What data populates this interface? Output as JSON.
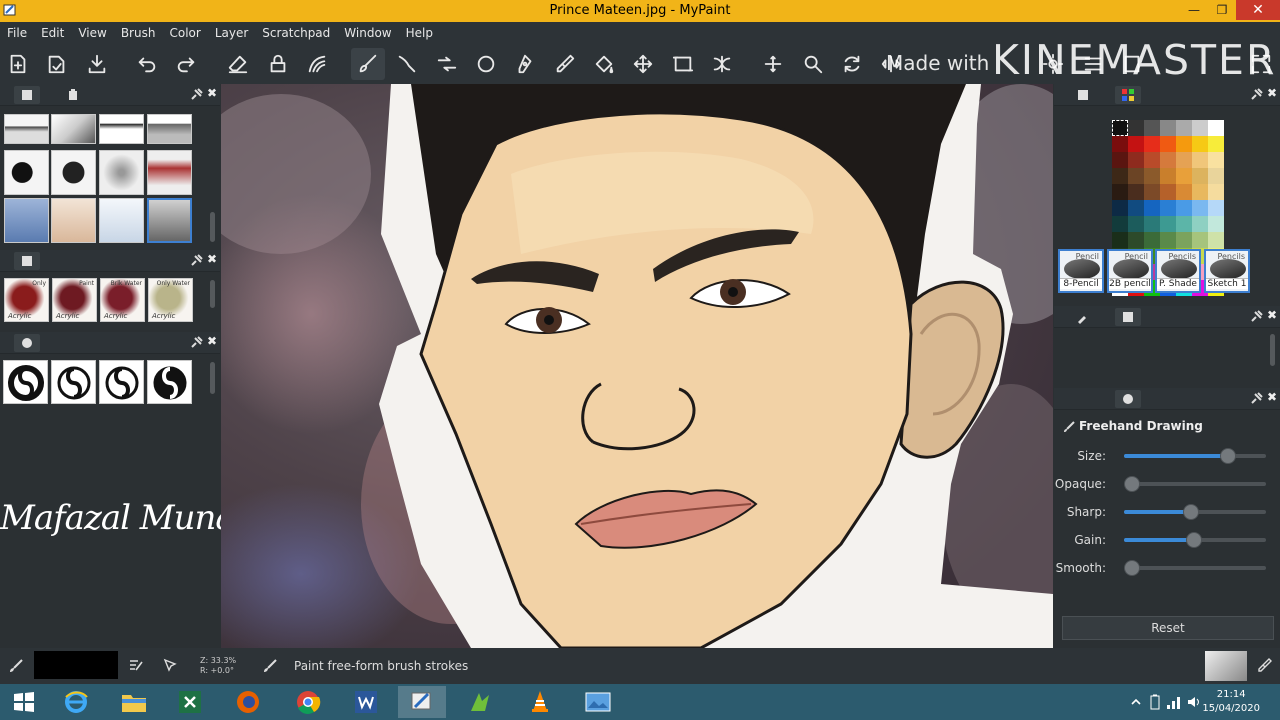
{
  "window": {
    "title": "Prince Mateen.jpg - MyPaint",
    "minimize_icon": "minimize-icon",
    "maximize_icon": "restore-icon",
    "close_icon": "close-icon"
  },
  "menu": [
    "File",
    "Edit",
    "View",
    "Brush",
    "Color",
    "Layer",
    "Scratchpad",
    "Window",
    "Help"
  ],
  "toolbar": {
    "icons": [
      "new-document-icon",
      "open-icon",
      "save-icon",
      "undo-icon",
      "redo-icon",
      "eraser-icon",
      "lock-alpha-icon",
      "brush-mode-icon",
      "freehand-brush-icon",
      "inking-icon",
      "line-icon",
      "ellipse-icon",
      "pen-icon",
      "color-picker-icon",
      "fill-icon",
      "move-layer-icon",
      "frame-icon",
      "symmetry-icon",
      "pan-icon",
      "zoom-icon",
      "rotate-icon",
      "flip-icon",
      "brush-settings-icon",
      "layers-icon",
      "menu-icon",
      "fullscreen-icon"
    ],
    "active": "freehand-brush-icon"
  },
  "watermark": {
    "made_with": "Made with",
    "brand": "KINEMASTER"
  },
  "left_panel": {
    "brushes_panel": {
      "tab_icons": [
        "brush-group-icon",
        "scratchpad-icon"
      ],
      "selected_index": 11
    },
    "paint_panel": {
      "labels": [
        "Acrylic",
        "Acrylic",
        "Acrylic",
        "Acrylic"
      ],
      "sub_labels": [
        "Only",
        "Paint",
        "Brlk Water",
        "Only Water"
      ]
    },
    "stroke_panel": {
      "count": 4
    },
    "signature": "Mafazal Muna"
  },
  "right_panel": {
    "palette": {
      "colors": [
        "#111111",
        "#333333",
        "#555555",
        "#888888",
        "#aaaaaa",
        "#cccccc",
        "#ffffff",
        "#7a0d0d",
        "#c41212",
        "#e62d1a",
        "#f05a12",
        "#f59a0e",
        "#f6c915",
        "#f7ec3a",
        "#5a1510",
        "#8e2b1e",
        "#b94b2a",
        "#d57a3c",
        "#e5a254",
        "#f0c67a",
        "#f9e1a0",
        "#3d2817",
        "#6b4425",
        "#8b5a2b",
        "#c97f2c",
        "#e8a03a",
        "#dcb35e",
        "#e9d49b",
        "#2a1b12",
        "#4a2d1e",
        "#7c4a28",
        "#b5612a",
        "#d98a34",
        "#e8b85e",
        "#f5dc9e",
        "#0d2a45",
        "#114b80",
        "#1565c0",
        "#2a7fd4",
        "#4a9be6",
        "#7ab8f0",
        "#b5d8f8",
        "#123b3b",
        "#1c5c5c",
        "#2a7a78",
        "#3d9a92",
        "#5cb5a8",
        "#8ed0c2",
        "#c2e8dc",
        "#1a2e1a",
        "#2d4a2a",
        "#3b6b38",
        "#5a8a4a",
        "#7ba35e",
        "#a6c47c",
        "#cfe2a8",
        "#223b1a",
        "#2f5d1f",
        "#3f8a22",
        "#6aa51e",
        "#9cc236",
        "#c9d94e",
        "#e9f07a",
        "#6a1b6a",
        "#8e2a8e",
        "#b83c9c",
        "#d94f8a",
        "#ef6f9e",
        "#f59fbf",
        "#f9cadc",
        "#ffffff",
        "#e01010",
        "#10c010",
        "#1060e0",
        "#10e0e0",
        "#e010e0",
        "#f0f010"
      ]
    },
    "brushset": {
      "tags": [
        "Pencil",
        "Pencil",
        "Pencils",
        "Pencils"
      ],
      "names": [
        "8-Pencil",
        "2B pencil",
        "P. Shade",
        "Sketch 1"
      ]
    },
    "brush_settings": {
      "title": "Freehand Drawing",
      "sliders": [
        {
          "label": "Size:",
          "value": 0.73
        },
        {
          "label": "Opaque:",
          "value": 0.0
        },
        {
          "label": "Sharp:",
          "value": 0.47
        },
        {
          "label": "Gain:",
          "value": 0.49
        },
        {
          "label": "Smooth:",
          "value": 0.0
        }
      ],
      "reset_label": "Reset"
    }
  },
  "status": {
    "zoom": "Z: 33.3%",
    "rotation": "R: +0.0°",
    "message": "Paint free-form brush strokes",
    "color": "#000000"
  },
  "taskbar": {
    "apps": [
      "windows-start-icon",
      "internet-explorer-icon",
      "file-explorer-icon",
      "excel-icon",
      "firefox-icon",
      "chrome-icon",
      "word-icon",
      "mypaint-icon",
      "camtasia-icon",
      "vlc-icon",
      "photos-icon"
    ],
    "active_app": "mypaint-icon",
    "time": "21:14",
    "date": "15/04/2020"
  }
}
